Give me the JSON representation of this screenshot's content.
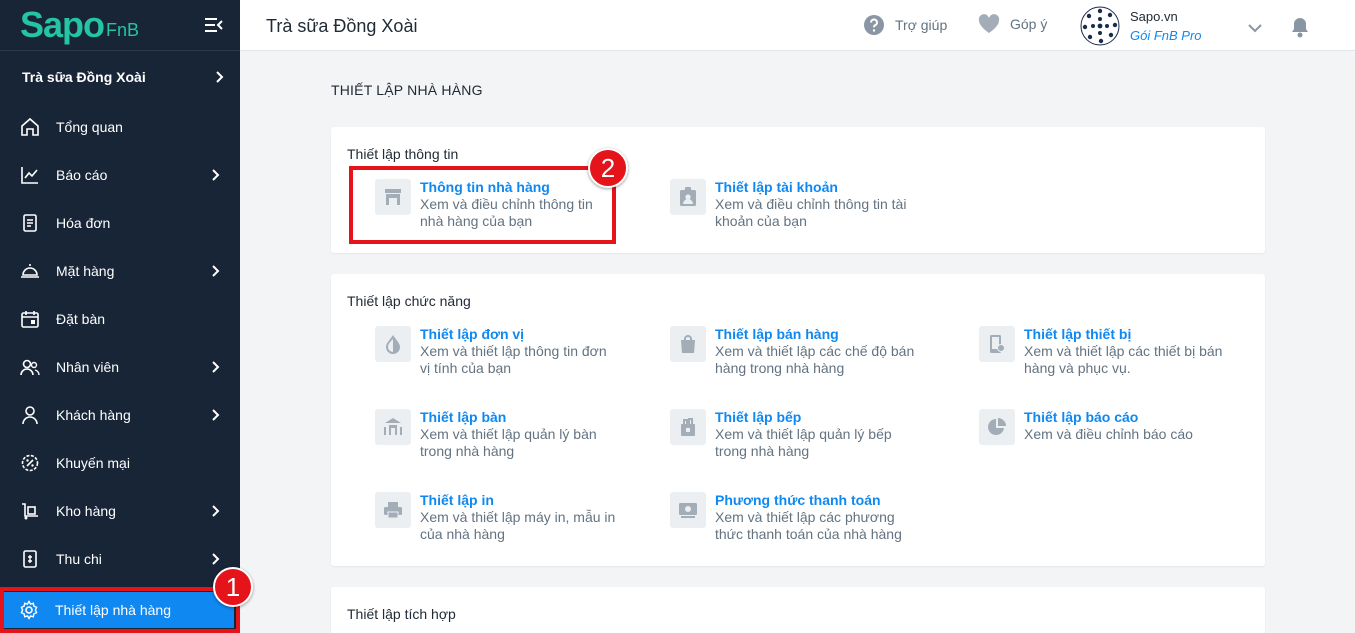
{
  "brand": {
    "logo_main": "Sapo",
    "logo_sub": "FnB"
  },
  "store": {
    "name": "Trà sữa Đồng Xoài"
  },
  "sidebar": {
    "items": [
      {
        "label": "Tổng quan",
        "icon": "home-icon",
        "has_children": false
      },
      {
        "label": "Báo cáo",
        "icon": "chart-icon",
        "has_children": true
      },
      {
        "label": "Hóa đơn",
        "icon": "invoice-icon",
        "has_children": false
      },
      {
        "label": "Mặt hàng",
        "icon": "dish-icon",
        "has_children": true
      },
      {
        "label": "Đặt bàn",
        "icon": "calendar-icon",
        "has_children": false
      },
      {
        "label": "Nhân viên",
        "icon": "staff-icon",
        "has_children": true
      },
      {
        "label": "Khách hàng",
        "icon": "customer-icon",
        "has_children": true
      },
      {
        "label": "Khuyến mại",
        "icon": "promotion-icon",
        "has_children": false
      },
      {
        "label": "Kho hàng",
        "icon": "warehouse-icon",
        "has_children": true
      },
      {
        "label": "Thu chi",
        "icon": "cashbook-icon",
        "has_children": true
      }
    ],
    "active": {
      "label": "Thiết lập nhà hàng",
      "icon": "gear-icon"
    }
  },
  "header": {
    "title": "Trà sữa Đồng Xoài",
    "help": "Trợ giúp",
    "feedback": "Góp ý",
    "account_name": "Sapo.vn",
    "account_plan": "Gói FnB Pro"
  },
  "main": {
    "heading": "THIẾT LẬP NHÀ HÀNG",
    "info_section": {
      "title": "Thiết lập thông tin",
      "tiles": [
        {
          "title": "Thông tin nhà hàng",
          "desc": "Xem và điều chỉnh thông tin nhà hàng của bạn",
          "icon": "store-icon"
        },
        {
          "title": "Thiết lập tài khoản",
          "desc": "Xem và điều chỉnh thông tin tài khoản của bạn",
          "icon": "account-icon"
        }
      ]
    },
    "function_section": {
      "title": "Thiết lập chức năng",
      "tiles": [
        {
          "title": "Thiết lập đơn vị",
          "desc": "Xem và thiết lập thông tin đơn vị tính của bạn",
          "icon": "drop-icon"
        },
        {
          "title": "Thiết lập bán hàng",
          "desc": "Xem và thiết lập các chế độ bán hàng trong nhà hàng",
          "icon": "shopping-bag-icon"
        },
        {
          "title": "Thiết lập thiết bị",
          "desc": "Xem và thiết lập các thiết bị bán hàng và phục vụ.",
          "icon": "device-icon"
        },
        {
          "title": "Thiết lập bàn",
          "desc": "Xem và thiết lập quản lý bàn trong nhà hàng",
          "icon": "table-icon"
        },
        {
          "title": "Thiết lập bếp",
          "desc": "Xem và thiết lập quản lý bếp trong nhà hàng",
          "icon": "kitchen-icon"
        },
        {
          "title": "Thiết lập báo cáo",
          "desc": "Xem và điều chỉnh báo cáo",
          "icon": "pie-chart-icon"
        },
        {
          "title": "Thiết lập in",
          "desc": "Xem và thiết lập máy in, mẫu in của nhà hàng",
          "icon": "printer-icon"
        },
        {
          "title": "Phương thức thanh toán",
          "desc": "Xem và thiết lập các phương thức thanh toán của nhà hàng",
          "icon": "payment-icon"
        }
      ]
    },
    "integration_section": {
      "title": "Thiết lập tích hợp"
    }
  },
  "annotations": {
    "badge_1": "1",
    "badge_2": "2",
    "highlight_color": "#e5131a"
  },
  "colors": {
    "sidebar_bg": "#182537",
    "accent": "#0f88f2",
    "brand": "#24c4a5"
  }
}
